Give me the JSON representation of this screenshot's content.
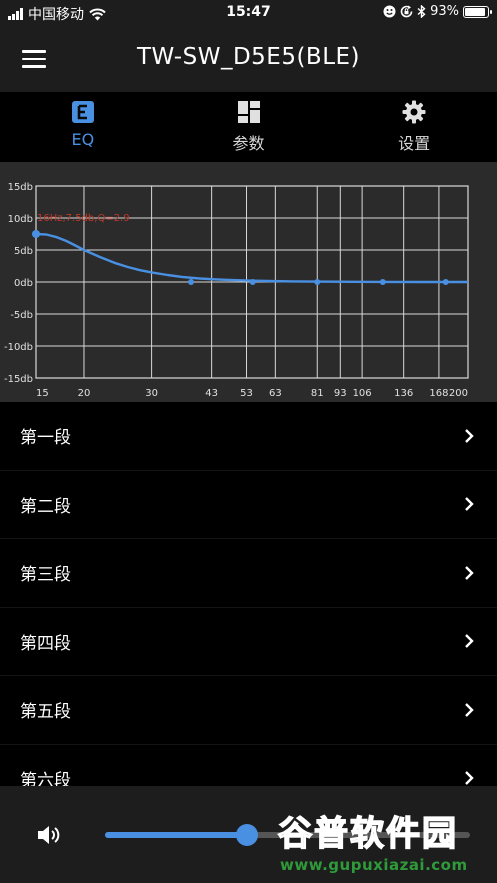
{
  "status": {
    "carrier": "中国移动",
    "time": "15:47",
    "battery_percent": "93%",
    "battery_level": 0.93,
    "icons": [
      "signal-icon",
      "wifi-icon",
      "face-icon",
      "rotation-lock-icon",
      "bluetooth-icon",
      "battery-icon"
    ]
  },
  "app_bar": {
    "title": "TW-SW_D5E5(BLE)"
  },
  "tabs": [
    {
      "label": "EQ",
      "icon": "eq-icon",
      "active": true
    },
    {
      "label": "参数",
      "icon": "dashboard-icon",
      "active": false
    },
    {
      "label": "设置",
      "icon": "gear-icon",
      "active": false
    }
  ],
  "colors": {
    "accent": "#4a90e2",
    "annotation": "#c0392b",
    "background": "#000000",
    "bar": "#1d1d1d",
    "chart_bg": "#2b2b2b"
  },
  "chart_data": {
    "type": "line",
    "y_ticks": [
      15,
      10,
      5,
      0,
      -5,
      -10,
      -15
    ],
    "y_tick_labels": [
      "15db",
      "10db",
      "5db",
      "0db",
      "-5db",
      "-10db",
      "-15db"
    ],
    "ylim": [
      -15,
      15
    ],
    "xlim": [
      15,
      200
    ],
    "x_ticks": [
      15,
      20,
      30,
      43,
      53,
      63,
      81,
      93,
      106,
      136,
      168,
      200
    ],
    "x_tick_labels": [
      "15",
      "20",
      "30",
      "43",
      "53",
      "63",
      "81",
      "93",
      "106",
      "136",
      "168",
      "200"
    ],
    "x_scale": "log",
    "grid": true,
    "annotation": "16Hz,7.5db,Q=2.9",
    "curve": {
      "x": [
        15,
        16,
        17,
        18,
        19,
        20,
        22,
        24,
        26,
        28,
        30,
        33,
        36,
        40,
        45,
        50,
        55,
        60,
        70,
        80,
        100,
        120,
        150,
        200
      ],
      "y": [
        7.5,
        7.4,
        7.0,
        6.4,
        5.7,
        5.0,
        3.9,
        3.0,
        2.35,
        1.85,
        1.5,
        1.1,
        0.8,
        0.55,
        0.38,
        0.28,
        0.2,
        0.16,
        0.1,
        0.06,
        0.03,
        0.02,
        0.0,
        0.0
      ]
    },
    "points": [
      {
        "x": 15,
        "y": 7.5
      },
      {
        "x": 38,
        "y": 0
      },
      {
        "x": 55,
        "y": 0
      },
      {
        "x": 81,
        "y": 0
      },
      {
        "x": 120,
        "y": 0
      },
      {
        "x": 175,
        "y": 0
      }
    ]
  },
  "bands": [
    {
      "label": "第一段"
    },
    {
      "label": "第二段"
    },
    {
      "label": "第三段"
    },
    {
      "label": "第四段"
    },
    {
      "label": "第五段"
    },
    {
      "label": "第六段"
    }
  ],
  "volume": {
    "icon": "speaker-icon",
    "level": 0.39
  },
  "watermark": {
    "text": "谷普软件园",
    "url": "www.gupuxiazai.com"
  }
}
